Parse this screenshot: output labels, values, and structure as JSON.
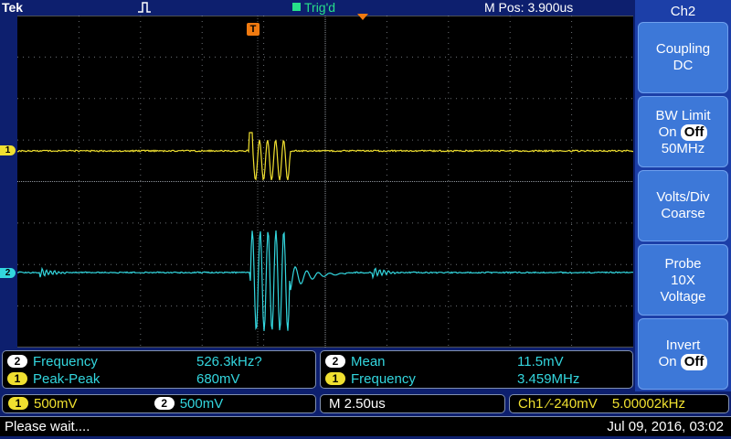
{
  "header": {
    "brand": "Tek",
    "trigger_status": "Trig'd",
    "m_pos": "M Pos: 3.900us",
    "trigger_marker": "T",
    "ch1_marker": "1",
    "ch2_marker": "2"
  },
  "side_menu": {
    "title": "Ch2",
    "coupling": {
      "label": "Coupling",
      "value": "DC"
    },
    "bw_limit": {
      "label": "BW Limit",
      "on": "On",
      "off": "Off",
      "bw": "50MHz"
    },
    "volts_div": {
      "label": "Volts/Div",
      "value": "Coarse"
    },
    "probe": {
      "label": "Probe",
      "value": "10X",
      "type": "Voltage"
    },
    "invert": {
      "label": "Invert",
      "on": "On",
      "off": "Off"
    }
  },
  "measurements_left": [
    {
      "channel": "2",
      "name": "Frequency",
      "value": "526.3kHz?"
    },
    {
      "channel": "1",
      "name": "Peak-Peak",
      "value": "680mV"
    }
  ],
  "measurements_right": [
    {
      "channel": "2",
      "name": "Mean",
      "value": "11.5mV"
    },
    {
      "channel": "1",
      "name": "Frequency",
      "value": "3.459MHz"
    }
  ],
  "status_bar": {
    "ch1_badge": "1",
    "ch1_scale": "500mV",
    "ch2_badge": "2",
    "ch2_scale": "500mV",
    "timebase": "M 2.50us",
    "trigger_source": "Ch1",
    "trigger_slope": "⁄",
    "trigger_level": "-240mV",
    "trigger_freq": "5.00002kHz"
  },
  "message": "Please wait....",
  "datetime": "Jul 09, 2016, 03:02",
  "colors": {
    "ch1": "#f0e030",
    "ch2": "#33d6de",
    "trigger": "#f07a10",
    "trigd": "#27e08a"
  }
}
